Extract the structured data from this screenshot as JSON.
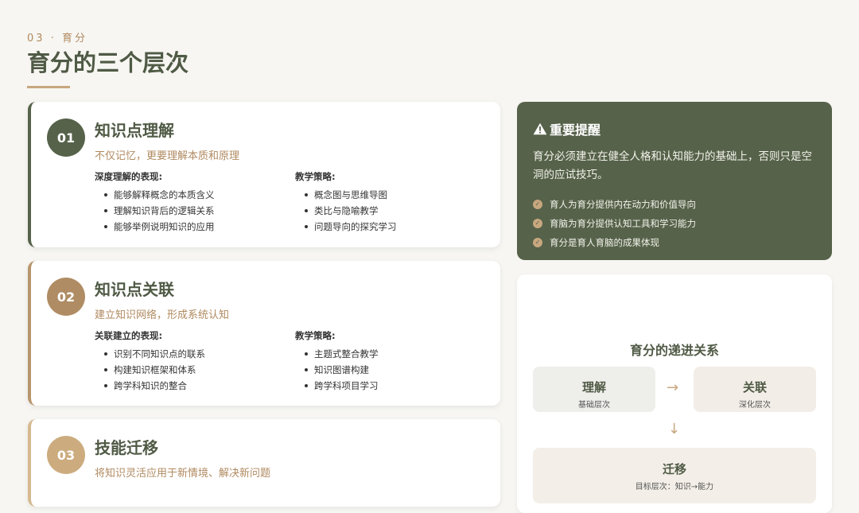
{
  "header": {
    "kicker": "03 · 育分",
    "title": "育分的三个层次"
  },
  "cards": [
    {
      "number": "01",
      "title": "知识点理解",
      "subtitle": "不仅记忆，更要理解本质和原理",
      "left_head": "深度理解的表现:",
      "left_items": [
        "能够解释概念的本质含义",
        "理解知识背后的逻辑关系",
        "能够举例说明知识的应用"
      ],
      "right_head": "教学策略:",
      "right_items": [
        "概念图与思维导图",
        "类比与隐喻教学",
        "问题导向的探究学习"
      ]
    },
    {
      "number": "02",
      "title": "知识点关联",
      "subtitle": "建立知识网络，形成系统认知",
      "left_head": "关联建立的表现:",
      "left_items": [
        "识别不同知识点的联系",
        "构建知识框架和体系",
        "跨学科知识的整合"
      ],
      "right_head": "教学策略:",
      "right_items": [
        "主题式整合教学",
        "知识图谱构建",
        "跨学科项目学习"
      ]
    },
    {
      "number": "03",
      "title": "技能迁移",
      "subtitle": "将知识灵活应用于新情境、解决新问题"
    }
  ],
  "reminder": {
    "icon": "warning-icon",
    "title": "重要提醒",
    "body": "育分必须建立在健全人格和认知能力的基础上，否则只是空洞的应试技巧。",
    "items": [
      "育人为育分提供内在动力和价值导向",
      "育脑为育分提供认知工具和学习能力",
      "育分是育人育脑的成果体现"
    ]
  },
  "progression": {
    "title": "育分的递进关系",
    "boxes": [
      {
        "title": "理解",
        "sub": "基础层次"
      },
      {
        "title": "关联",
        "sub": "深化层次"
      },
      {
        "title": "迁移",
        "sub": "目标层次：知识→能力"
      }
    ],
    "arrow_right": "→",
    "arrow_down": "↓"
  },
  "colors": {
    "accent_green": "#56624a",
    "accent_gold": "#c8a77f",
    "background": "#f7f6f2"
  }
}
